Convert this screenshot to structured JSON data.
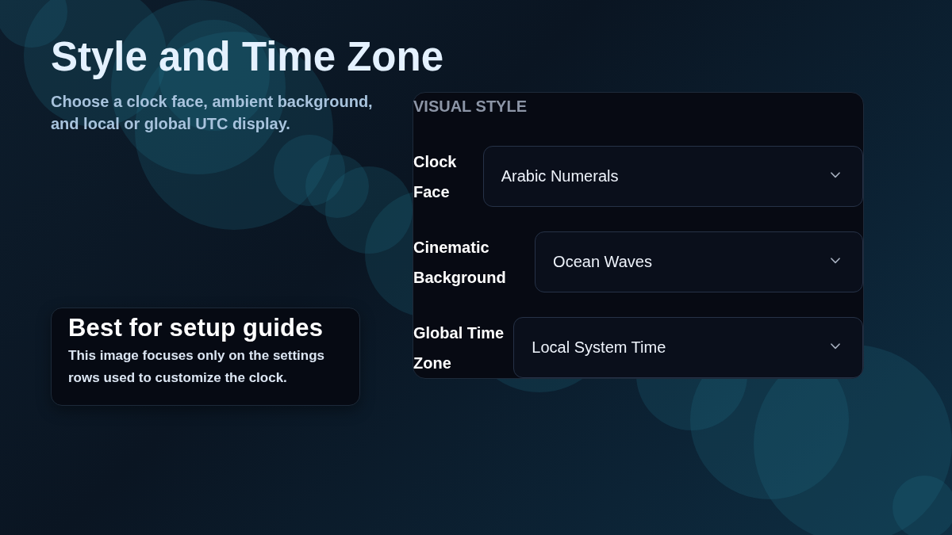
{
  "header": {
    "title": "Style and Time Zone",
    "subtitle": "Choose a clock face, ambient background, and local or global UTC display."
  },
  "note_card": {
    "title": "Best for setup guides",
    "body": "This image focuses only on the settings rows used to customize the clock."
  },
  "settings_panel": {
    "heading": "VISUAL STYLE",
    "rows": [
      {
        "label": "Clock Face",
        "value": "Arabic Numerals"
      },
      {
        "label": "Cinematic Background",
        "value": "Ocean Waves"
      },
      {
        "label": "Global Time Zone",
        "value": "Local System Time"
      }
    ]
  }
}
